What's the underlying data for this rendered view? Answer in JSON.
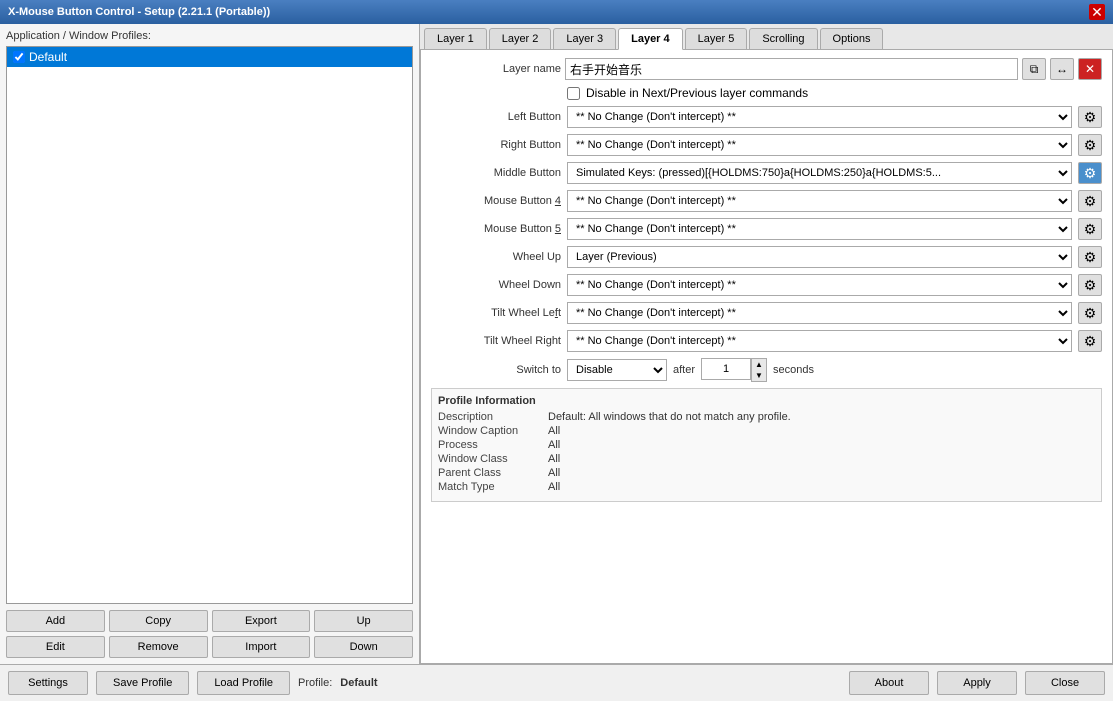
{
  "titleBar": {
    "title": "X-Mouse Button Control - Setup (2.21.1 (Portable))"
  },
  "leftPanel": {
    "title": "Application / Window Profiles:",
    "profiles": [
      {
        "label": "Default",
        "checked": true,
        "selected": true
      }
    ],
    "buttons": {
      "add": "Add",
      "copy": "Copy",
      "export": "Export",
      "up": "Up",
      "edit": "Edit",
      "remove": "Remove",
      "import": "Import",
      "down": "Down"
    }
  },
  "tabs": [
    {
      "id": "layer1",
      "label": "Layer 1"
    },
    {
      "id": "layer2",
      "label": "Layer 2"
    },
    {
      "id": "layer3",
      "label": "Layer 3"
    },
    {
      "id": "layer4",
      "label": "Layer 4",
      "active": true
    },
    {
      "id": "layer5",
      "label": "Layer 5"
    },
    {
      "id": "scrolling",
      "label": "Scrolling"
    },
    {
      "id": "options",
      "label": "Options"
    }
  ],
  "layer4": {
    "layerNameLabel": "Layer name",
    "layerNameValue": "右手开始音乐",
    "disableCheckboxLabel": "Disable in Next/Previous layer commands",
    "leftButtonLabel": "Left Button",
    "leftButtonValue": "** No Change (Don't intercept) **",
    "rightButtonLabel": "Right Button",
    "rightButtonValue": "** No Change (Don't intercept) **",
    "middleButtonLabel": "Middle Button",
    "middleButtonValue": "Simulated Keys: (pressed)[{HOLDMS:750}a{HOLDMS:250}a{HOLDMS:5...",
    "mouseButton4Label": "Mouse Button 4",
    "mouseButton4Value": "** No Change (Don't intercept) **",
    "mouseButton5Label": "Mouse Button 5",
    "mouseButton5Value": "** No Change (Don't intercept) **",
    "wheelUpLabel": "Wheel Up",
    "wheelUpValue": "Layer (Previous)",
    "wheelDownLabel": "Wheel Down",
    "wheelDownValue": "** No Change (Don't intercept) **",
    "tiltWheelLeftLabel": "Tilt Wheel Left",
    "tiltWheelLeftValue": "** No Change (Don't intercept) **",
    "tiltWheelRightLabel": "Tilt Wheel Right",
    "tiltWheelRightValue": "** No Change (Don't intercept) **",
    "switchToLabel": "Switch to",
    "switchToValue": "Disable",
    "afterLabel": "after",
    "secondsValue": "1",
    "secondsLabel": "seconds"
  },
  "profileInfo": {
    "sectionTitle": "Profile Information",
    "rows": [
      {
        "label": "Description",
        "value": "Default: All windows that do not match any profile."
      },
      {
        "label": "Window Caption",
        "value": "All"
      },
      {
        "label": "Process",
        "value": "All"
      },
      {
        "label": "Window Class",
        "value": "All"
      },
      {
        "label": "Parent Class",
        "value": "All"
      },
      {
        "label": "Match Type",
        "value": "All"
      }
    ]
  },
  "bottomBar": {
    "settingsLabel": "Settings",
    "saveProfileLabel": "Save Profile",
    "loadProfileLabel": "Load Profile",
    "profileTextLabel": "Profile:",
    "profileValue": "Default",
    "aboutLabel": "About",
    "applyLabel": "Apply",
    "closeLabel": "Close"
  },
  "noChangeText": "** No Change (Don't intercept) **",
  "icons": {
    "copy": "⧉",
    "arrows": "↔",
    "close": "✕",
    "gear": "⚙",
    "spinUp": "▲",
    "spinDown": "▼",
    "window": "☐"
  }
}
